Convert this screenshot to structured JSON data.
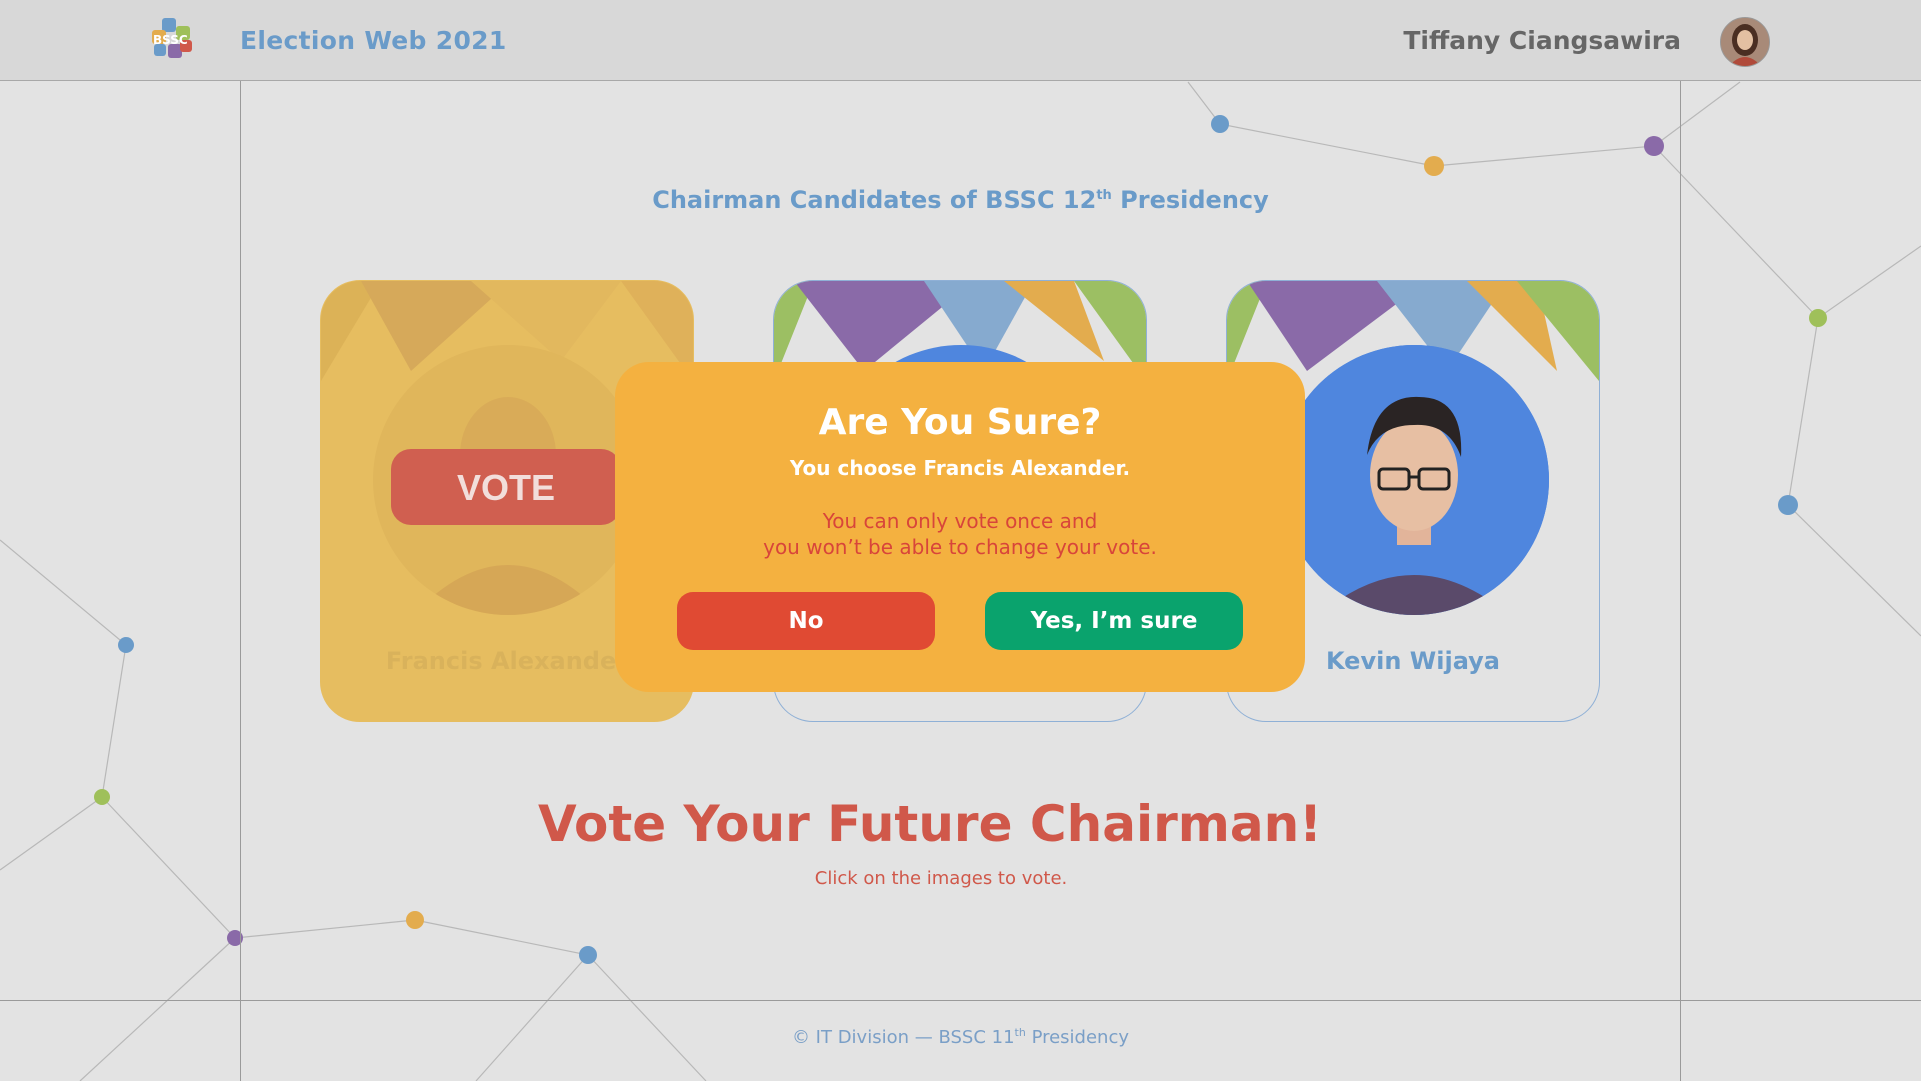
{
  "header": {
    "logo_text": "BSSC",
    "app_title": "Election Web 2021",
    "user_name": "Tiffany Ciangsawira"
  },
  "main": {
    "section_title": "Chairman Candidates of BSSC 12",
    "section_title_sup": "th",
    "section_title_suffix": " Presidency",
    "candidates": [
      {
        "name": "Francis Alexander",
        "selected": true,
        "vote_label": "VOTE"
      },
      {
        "name": "",
        "selected": false
      },
      {
        "name": "Kevin Wijaya",
        "selected": false
      }
    ],
    "headline": "Vote Your Future Chairman!",
    "subline": "Click on the images to vote."
  },
  "modal": {
    "title": "Are You Sure?",
    "subtitle": "You choose Francis Alexander.",
    "warning_line1": "You can only vote once and",
    "warning_line2": "you won’t be able to change your vote.",
    "no_label": "No",
    "yes_label": "Yes, I’m sure"
  },
  "footer": {
    "prefix": "© IT Division — BSSC 11",
    "sup": "th",
    "suffix": " Presidency"
  },
  "colors": {
    "accent_blue": "#6a9bc9",
    "accent_red": "#d0584a",
    "modal_bg": "#f4b140",
    "no_button": "#e04a33",
    "yes_button": "#0aa36d"
  }
}
